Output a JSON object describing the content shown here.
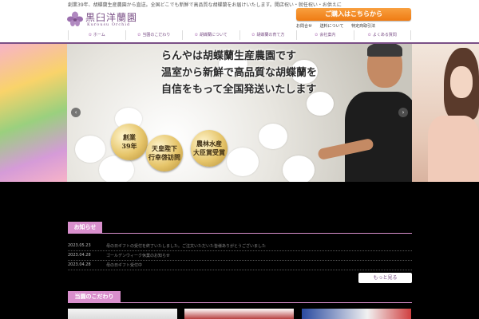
{
  "header": {
    "tagline": "創業39年、胡蝶蘭生産農園から直送。全国どこでも新鮮で高品質な胡蝶蘭をお届けいたします。開店祝い・就任祝い・お供えに",
    "logo_title": "黒臼洋蘭園",
    "logo_subtitle": "Kurousu Orchid",
    "buy_button": "ご購入はこちらから",
    "top_links": [
      "お問合せ",
      "送料について",
      "特定商取引法"
    ]
  },
  "nav": {
    "items": [
      "ホーム",
      "当園のこだわり",
      "胡蝶蘭について",
      "胡蝶蘭の育て方",
      "会社案内",
      "よくある質問"
    ]
  },
  "hero": {
    "headline": [
      "らんやは胡蝶蘭生産農園です",
      "温室から新鮮で高品質な胡蝶蘭を",
      "自信をもって全国発送いたします"
    ],
    "badges": [
      {
        "line1": "創業",
        "line2": "39年"
      },
      {
        "line1": "天皇陛下",
        "line2": "行幸啓訪問"
      },
      {
        "line1": "農林水産",
        "line2": "大臣賞受賞"
      }
    ],
    "prev": "‹",
    "next": "›"
  },
  "news": {
    "heading": "お知らせ",
    "items": [
      {
        "date": "2023.05.23",
        "title": "母の日ギフトの受付を終了いたしました。ご注文いただいた皆様ありがとうございました"
      },
      {
        "date": "2023.04.28",
        "title": "ゴールデンウィーク休業のお知らせ"
      },
      {
        "date": "2023.04.28",
        "title": "母の日ギフト受付中"
      }
    ],
    "more": "もっと見る"
  },
  "section2": {
    "heading": "当園のこだわり"
  },
  "colors": {
    "brand": "#7a4f86",
    "accent": "#ef7b13",
    "section": "#d98fcd"
  }
}
